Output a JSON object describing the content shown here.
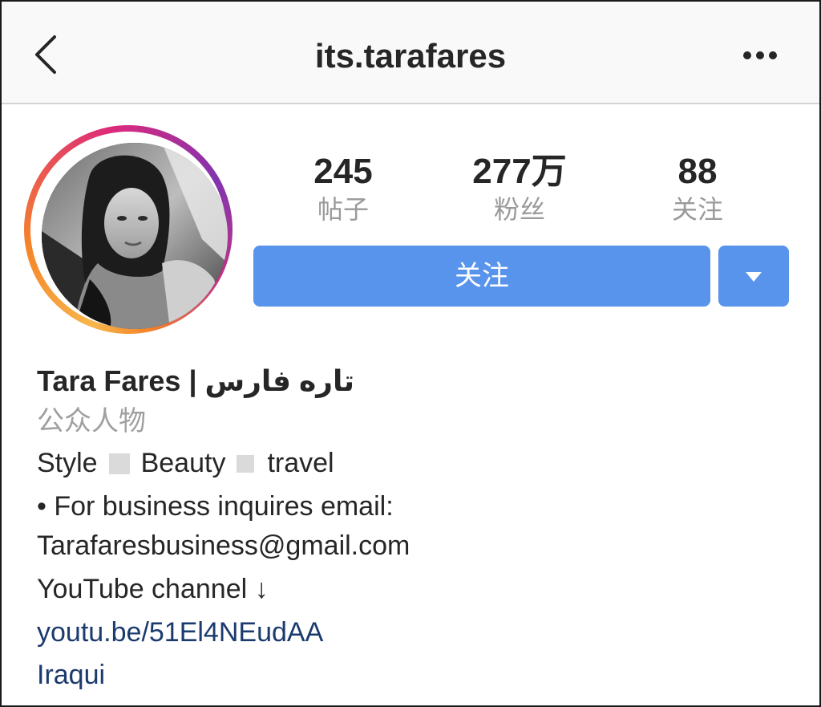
{
  "header": {
    "username": "its.tarafares"
  },
  "stats": {
    "posts": {
      "value": "245",
      "label": "帖子"
    },
    "followers": {
      "value": "277万",
      "label": "粉丝"
    },
    "following": {
      "value": "88",
      "label": "关注"
    }
  },
  "actions": {
    "follow_label": "关注"
  },
  "bio": {
    "name": "Tara Fares | تاره فارس",
    "category": "公众人物",
    "tags": [
      "Style",
      "Beauty",
      "travel"
    ],
    "business_line": "• For business inquires email:",
    "email": "Tarafaresbusiness@gmail.com",
    "youtube_line": "YouTube channel ↓",
    "youtube_link": "youtu.be/51El4NEudAA",
    "location_link": "Iraqui"
  },
  "colors": {
    "accent": "#5893ec",
    "link": "#1b3a6e",
    "muted": "#9a9a9a"
  }
}
